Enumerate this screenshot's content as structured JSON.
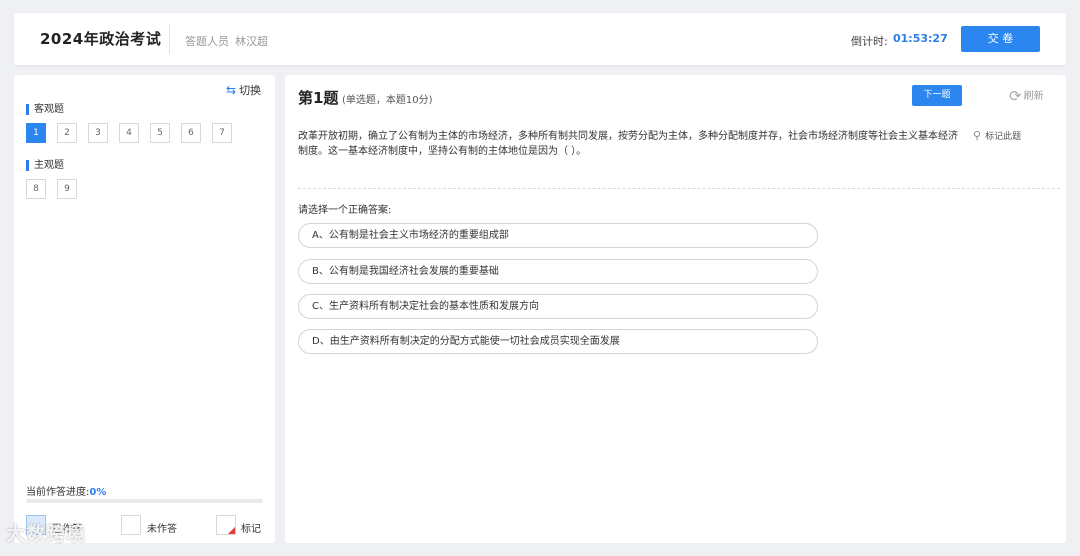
{
  "header": {
    "title": "2024年政治考试",
    "examinee_label": "答题人员",
    "examinee_name": "林汉超",
    "countdown_label": "倒计时:",
    "countdown_value": "01:53:27",
    "submit_label": "交 卷"
  },
  "sidebar": {
    "switch_label": "切换",
    "objective_label": "客观题",
    "objective_numbers": [
      "1",
      "2",
      "3",
      "4",
      "5",
      "6",
      "7"
    ],
    "subjective_label": "主观题",
    "subjective_numbers": [
      "8",
      "9"
    ],
    "progress_label": "当前作答进度:",
    "progress_value": "0%",
    "progress_fraction": 0,
    "legend": {
      "answered": "已作答",
      "unanswered": "未作答",
      "marked": "标记"
    }
  },
  "question": {
    "title": "第1题",
    "meta": "(单选题，本题10分)",
    "next_label": "下一题",
    "refresh_label": "刷新",
    "mark_label": "标记此题",
    "stem": "改革开放初期，确立了公有制为主体的市场经济，多种所有制共同发展，按劳分配为主体，多种分配制度并存，社会市场经济制度等社会主义基本经济制度。这一基本经济制度中，坚持公有制的主体地位是因为（ ）。",
    "prompt": "请选择一个正确答案:",
    "options": [
      "A、公有制是社会主义市场经济的重要组成部",
      "B、公有制是我国经济社会发展的重要基础",
      "C、生产资料所有制决定社会的基本性质和发展方向",
      "D、由生产资料所有制决定的分配方式能使一切社会成员实现全面发展"
    ]
  },
  "watermark": "大数跨境",
  "colors": {
    "accent": "#2b86f0",
    "background": "#eef0f3",
    "marked": "#e53935"
  }
}
